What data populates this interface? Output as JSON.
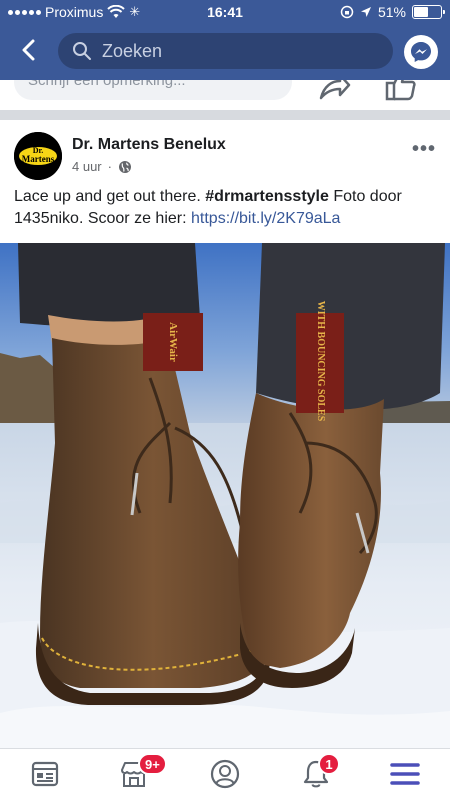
{
  "status_bar": {
    "carrier": "Proximus",
    "time": "16:41",
    "battery_percent": "51%",
    "battery_level": 0.51
  },
  "search": {
    "placeholder": "Zoeken"
  },
  "prev_post": {
    "comment_placeholder": "Schrijf een opmerking..."
  },
  "post": {
    "page_name": "Dr. Martens Benelux",
    "time_ago": "4 uur",
    "separator": "·",
    "text_intro": "Lace up and get out there. ",
    "hashtag": "#drmartensstyle",
    "text_middle": " Foto door 1435niko. Scoor ze hier: ",
    "link": "https://bit.ly/2K79aLa",
    "avatar_logo_text": "Dr. Martens",
    "image_tag_left": "AirWair",
    "image_tag_right": "WITH BOUNCING SOLES"
  },
  "bottom_nav": {
    "items": [
      {
        "name": "news-feed",
        "badge": ""
      },
      {
        "name": "marketplace",
        "badge": "9+"
      },
      {
        "name": "profile",
        "badge": ""
      },
      {
        "name": "notifications",
        "badge": "1"
      },
      {
        "name": "menu",
        "badge": ""
      }
    ]
  },
  "colors": {
    "brand": "#3b5998",
    "link": "#385898",
    "badge": "#e41e3f",
    "menu_active": "#4b4fb8"
  }
}
